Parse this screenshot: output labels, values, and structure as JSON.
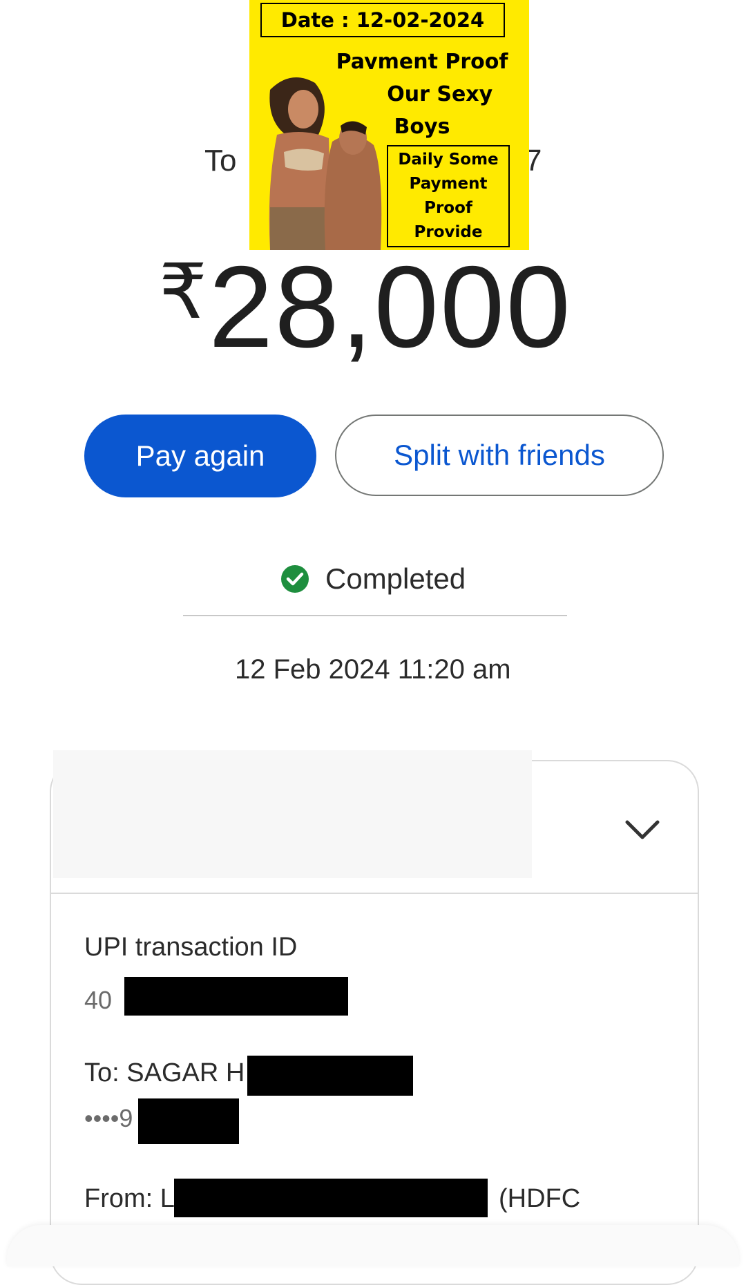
{
  "recipient": {
    "prefix": "To",
    "suffix": "7"
  },
  "banner": {
    "date": "Date : 12-02-2024",
    "title_lines": [
      "Payment Proof",
      "by Our Sexy",
      "Boys"
    ],
    "box_lines": [
      "Daily Some",
      "Payment",
      "Proof",
      "Provide"
    ],
    "background_color": "#ffea00"
  },
  "amount": {
    "currency_symbol": "₹",
    "value": "28,000"
  },
  "actions": {
    "pay_again": "Pay again",
    "split_with_friends": "Split with friends",
    "accent_color": "#0b57d0"
  },
  "status": {
    "label": "Completed",
    "icon": "check-circle-icon",
    "color": "#1e8e3e"
  },
  "datetime": "12 Feb 2024 11:20 am",
  "details": {
    "expand_icon": "chevron-down-icon",
    "upi_label": "UPI transaction ID",
    "upi_value_visible": "40",
    "to_line_visible": "To: SAGAR H",
    "to_account_visible": "••••9",
    "from_line_prefix": "From: L",
    "from_line_suffix": "(HDFC"
  }
}
